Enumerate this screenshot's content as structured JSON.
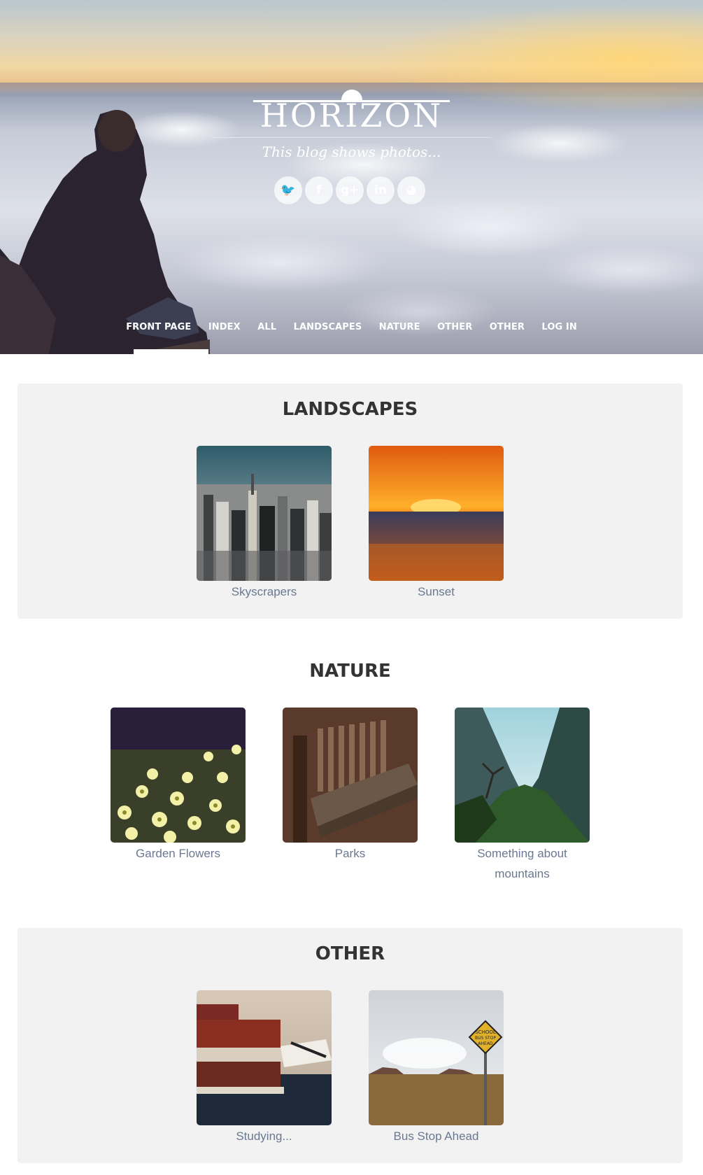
{
  "brand": {
    "logo": "HORIZON",
    "tagline": "This blog shows photos..."
  },
  "social": [
    {
      "icon": "twitter-icon",
      "glyph": "🐦"
    },
    {
      "icon": "facebook-icon",
      "glyph": "f"
    },
    {
      "icon": "google-plus-icon",
      "glyph": "g+"
    },
    {
      "icon": "linkedin-icon",
      "glyph": "in"
    },
    {
      "icon": "github-icon",
      "glyph": "◕"
    }
  ],
  "nav": {
    "items": [
      "FRONT PAGE",
      "INDEX",
      "ALL",
      "LANDSCAPES",
      "NATURE",
      "OTHER",
      "OTHER",
      "LOG IN"
    ],
    "active": "FRONT PAGE"
  },
  "sections": [
    {
      "title": "LANDSCAPES",
      "items": [
        "Skyscrapers",
        "Sunset"
      ]
    },
    {
      "title": "NATURE",
      "items": [
        "Garden Flowers",
        "Parks",
        "Something about mountains"
      ]
    },
    {
      "title": "OTHER",
      "items": [
        "Studying...",
        "Bus Stop Ahead"
      ]
    }
  ],
  "signs": {
    "bus_stop": [
      "SCHOOL",
      "BUS STOP",
      "AHEAD"
    ]
  }
}
